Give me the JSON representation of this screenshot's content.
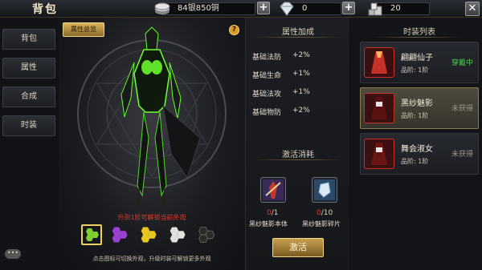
{
  "header": {
    "title": "背包",
    "silver": "84银850铜",
    "diamond": "0",
    "third_currency": "20"
  },
  "sidebar": {
    "items": [
      {
        "label": "背包"
      },
      {
        "label": "属性"
      },
      {
        "label": "合成"
      },
      {
        "label": "时装"
      }
    ]
  },
  "preview": {
    "overview_button": "属性总览",
    "unlock_hint": "升到1阶可解锁当前外观",
    "bottom_hint": "点击图标可切换外观，升级时装可解锁更多外观",
    "variants": [
      {
        "color": "#7fd030",
        "selected": true
      },
      {
        "color": "#9a40d0",
        "selected": false
      },
      {
        "color": "#e8c820",
        "selected": false
      },
      {
        "color": "#e0e0e0",
        "selected": false
      },
      {
        "color": "#3a3a3a",
        "selected": false
      }
    ]
  },
  "attributes": {
    "title": "属性加成",
    "stats": [
      {
        "name": "基础法防",
        "value": "+2%"
      },
      {
        "name": "基础生命",
        "value": "+1%"
      },
      {
        "name": "基础法攻",
        "value": "+1%"
      },
      {
        "name": "基础物防",
        "value": "+2%"
      }
    ],
    "cost_title": "激活消耗",
    "materials": [
      {
        "have": "0",
        "need": "/1",
        "name": "黑纱魅影本体"
      },
      {
        "have": "0",
        "need": "/10",
        "name": "黑纱魅影碎片"
      }
    ],
    "activate_button": "激活"
  },
  "fashion_list": {
    "title": "时装列表",
    "items": [
      {
        "name": "翩翩仙子",
        "grade": "品阶: 1阶",
        "status": "穿戴中"
      },
      {
        "name": "黑纱魅影",
        "grade": "品阶: 1阶",
        "status": "未获得"
      },
      {
        "name": "舞会淑女",
        "grade": "品阶: 1阶",
        "status": "未获得"
      }
    ]
  }
}
